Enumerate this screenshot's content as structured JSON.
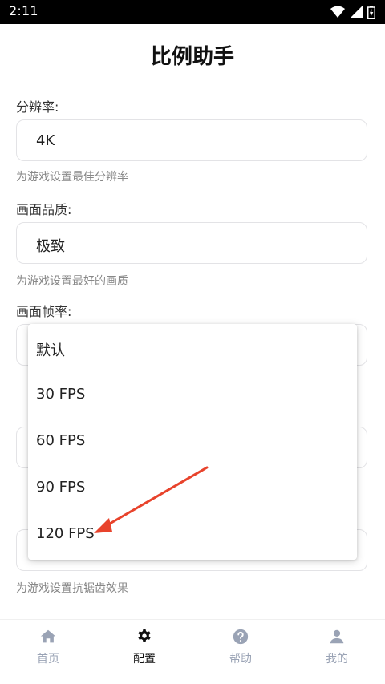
{
  "status_bar": {
    "time": "2:11"
  },
  "page_title": "比例助手",
  "sections": {
    "resolution": {
      "label": "分辨率:",
      "value": "4K",
      "hint": "为游戏设置最佳分辨率"
    },
    "quality": {
      "label": "画面品质:",
      "value": "极致",
      "hint": "为游戏设置最好的画质"
    },
    "framerate": {
      "label": "画面帧率:"
    },
    "antialias": {
      "hint": "为游戏设置抗锯齿效果"
    }
  },
  "dropdown": {
    "options": [
      "默认",
      "30 FPS",
      "60 FPS",
      "90 FPS",
      "120 FPS"
    ]
  },
  "annotation_color": "#e8432c",
  "bottom_nav": {
    "items": [
      {
        "label": "首页",
        "icon": "home-icon"
      },
      {
        "label": "配置",
        "icon": "gear-icon"
      },
      {
        "label": "帮助",
        "icon": "help-icon"
      },
      {
        "label": "我的",
        "icon": "user-icon"
      }
    ],
    "active_index": 1
  }
}
